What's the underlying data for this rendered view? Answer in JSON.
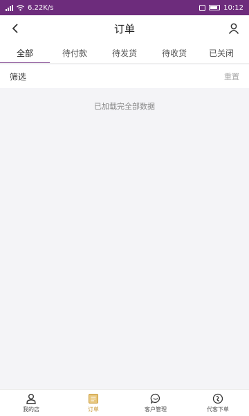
{
  "status_bar": {
    "network_speed": "6.22K/s",
    "time": "10:12"
  },
  "header": {
    "title": "订单",
    "back_icon": "chevron-left-icon",
    "user_icon": "user-icon"
  },
  "tabs": [
    {
      "label": "全部",
      "active": true
    },
    {
      "label": "待付款",
      "active": false
    },
    {
      "label": "待发货",
      "active": false
    },
    {
      "label": "待收货",
      "active": false
    },
    {
      "label": "已关闭",
      "active": false
    }
  ],
  "filter": {
    "label": "筛选",
    "reset_label": "重置"
  },
  "content": {
    "message": "已加载完全部数据"
  },
  "bottom_nav": [
    {
      "label": "我的店",
      "icon": "store-user-icon",
      "active": false
    },
    {
      "label": "订单",
      "icon": "order-icon",
      "active": true
    },
    {
      "label": "客户管理",
      "icon": "customer-icon",
      "active": false
    },
    {
      "label": "代客下单",
      "icon": "place-order-icon",
      "active": false
    }
  ],
  "colors": {
    "status_bar": "#6d2c7c",
    "active_tab_underline": "#7a3b8a",
    "active_nav": "#c99b3c"
  }
}
